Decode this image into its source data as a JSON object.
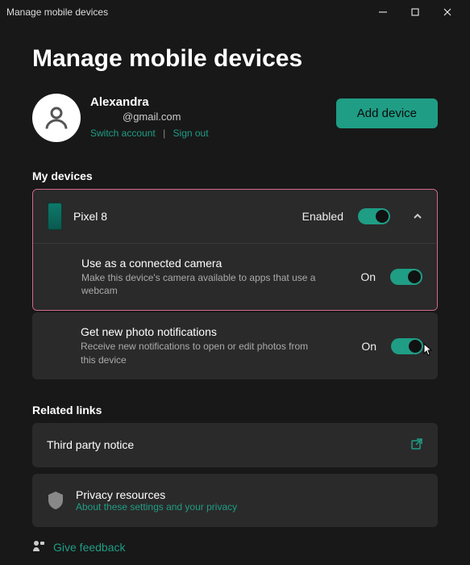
{
  "window": {
    "title": "Manage mobile devices"
  },
  "header": {
    "title": "Manage mobile devices"
  },
  "account": {
    "name_blurred": "Alexandra",
    "email_suffix": "@gmail.com",
    "switch_label": "Switch account",
    "signout_label": "Sign out"
  },
  "add_device_label": "Add device",
  "my_devices_label": "My devices",
  "device": {
    "name": "Pixel 8",
    "enabled_label": "Enabled",
    "camera": {
      "title": "Use as a connected camera",
      "sub": "Make this device's camera available to apps that use a webcam",
      "state": "On"
    },
    "photos": {
      "title": "Get new photo notifications",
      "sub": "Receive new notifications to open or edit photos from this device",
      "state": "On"
    }
  },
  "related": {
    "label": "Related links",
    "third_party": "Third party notice",
    "privacy_title": "Privacy resources",
    "privacy_link": "About these settings and your privacy"
  },
  "feedback": {
    "label": "Give feedback"
  }
}
